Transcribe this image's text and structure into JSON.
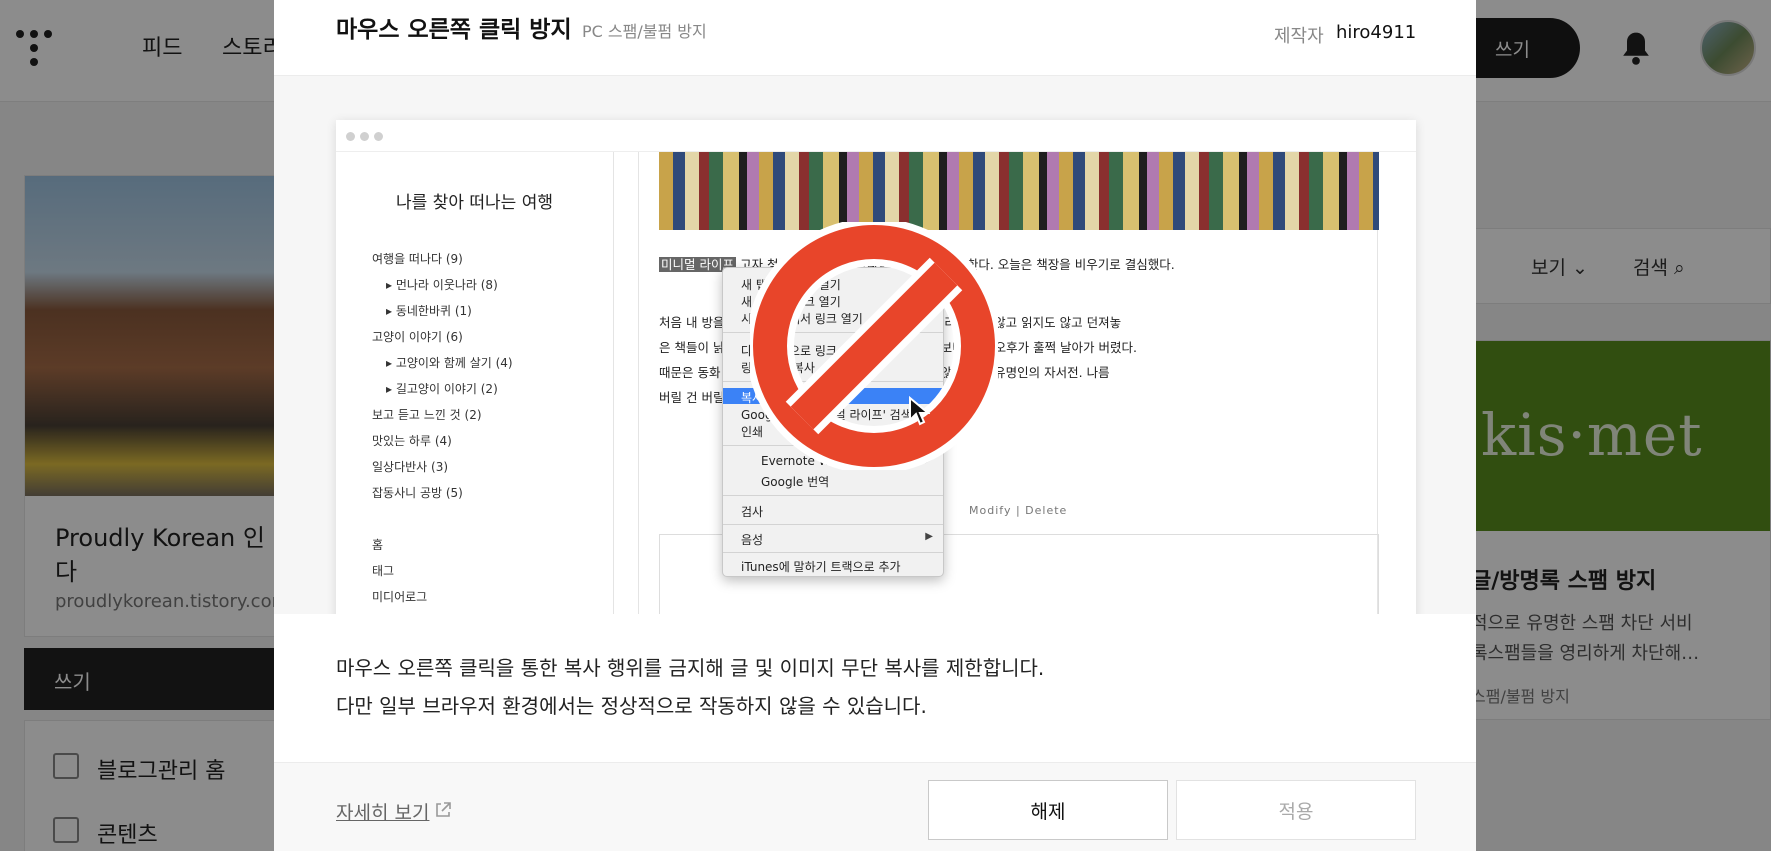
{
  "topbar": {
    "nav": [
      "피드",
      "스토리"
    ],
    "write_button": "쓰기"
  },
  "left_card": {
    "title": "Proudly Korean 인 캐나다",
    "url": "proudlykorean.tistory.com"
  },
  "sidebar": {
    "write": "쓰기",
    "items": [
      "블로그관리 홈",
      "콘텐츠"
    ]
  },
  "right_panel": {
    "view_label": "보기",
    "search_label": "검색",
    "card_image_text": "kis·met",
    "card_title": "글/방명록 스팸 방지",
    "card_desc": [
      "적으로 유명한 스팸 차단 서비",
      "록스팸들을 영리하게 차단해…"
    ],
    "card_category": "스팸/불펌 방지"
  },
  "modal": {
    "title": "마우스 오른쪽 클릭 방지",
    "category": "PC 스팸/불펌 방지",
    "maker_label": "제작자",
    "maker": "hiro4911",
    "description_lines": [
      "마우스 오른쪽 클릭을 통한 복사 행위를 금지해 글 및 이미지 무단 복사를 제한합니다.",
      "다만 일부 브라우저 환경에서는 정상적으로 작동하지 않을 수 있습니다."
    ],
    "more_link": "자세히 보기",
    "release_button": "해제",
    "apply_button": "적용"
  },
  "preview": {
    "blog_title": "나를 찾아 떠나는 여행",
    "categories": [
      "여행을 떠나다 (9)",
      "▸ 먼나라 이웃나라 (8)",
      "▸ 동네한바퀴 (1)",
      "고양이 이야기 (6)",
      "▸ 고양이와 함께 살기 (4)",
      "▸ 길고양이 이야기 (2)",
      "보고 듣고 느낀 것 (2)",
      "맛있는 하루 (4)",
      "일상다반사 (3)",
      "잡동사니 공방 (5)"
    ],
    "pages": [
      "홈",
      "태그",
      "미디어로그"
    ],
    "highlight": "미니멀 라이프",
    "paragraph1": "고자 청소하는 과정을 하나하나 남겨놓을까 한다. 오늘은 책장을 비우기로 결심했다.",
    "paragraph2_lines": [
      "처음 내 방을 인 오 서재의 이미지였을 텐데. 몇 년간 정리하지는 않고 읽지도 않고 던져놓",
      "은 책들이 낡 는 가 로 책을 한 권 두 권 꺼내 분류하다 보니 주말 오후가 훌쩍 날아가 버렸다.",
      "때문은 동화 징 후감 숙제 때문에 한 번 읽고 펼쳐보지 않은 어느 유명인의 자서전. 나름",
      "버릴 건 버릴 가 많을 줄이야."
    ],
    "actions": "Modify  |  Delete",
    "context_menu": [
      "새 탭에서 링크 열기",
      "새 창에서 링크 열기",
      "시크릿 창에서 링크 열기",
      "다른 이름으로 링크 저장",
      "링크 주소 복사",
      "복사",
      "Google에서 '미니멀 라이프' 검색",
      "인쇄",
      "Evernote Web Clipper",
      "Google 번역",
      "검사",
      "음성",
      "iTunes에 말하기 트랙으로 추가"
    ]
  },
  "colors": {
    "accent_red": "#e8452a",
    "menu_highlight": "#3b82f6",
    "kismet_green": "#5a8f1e"
  }
}
